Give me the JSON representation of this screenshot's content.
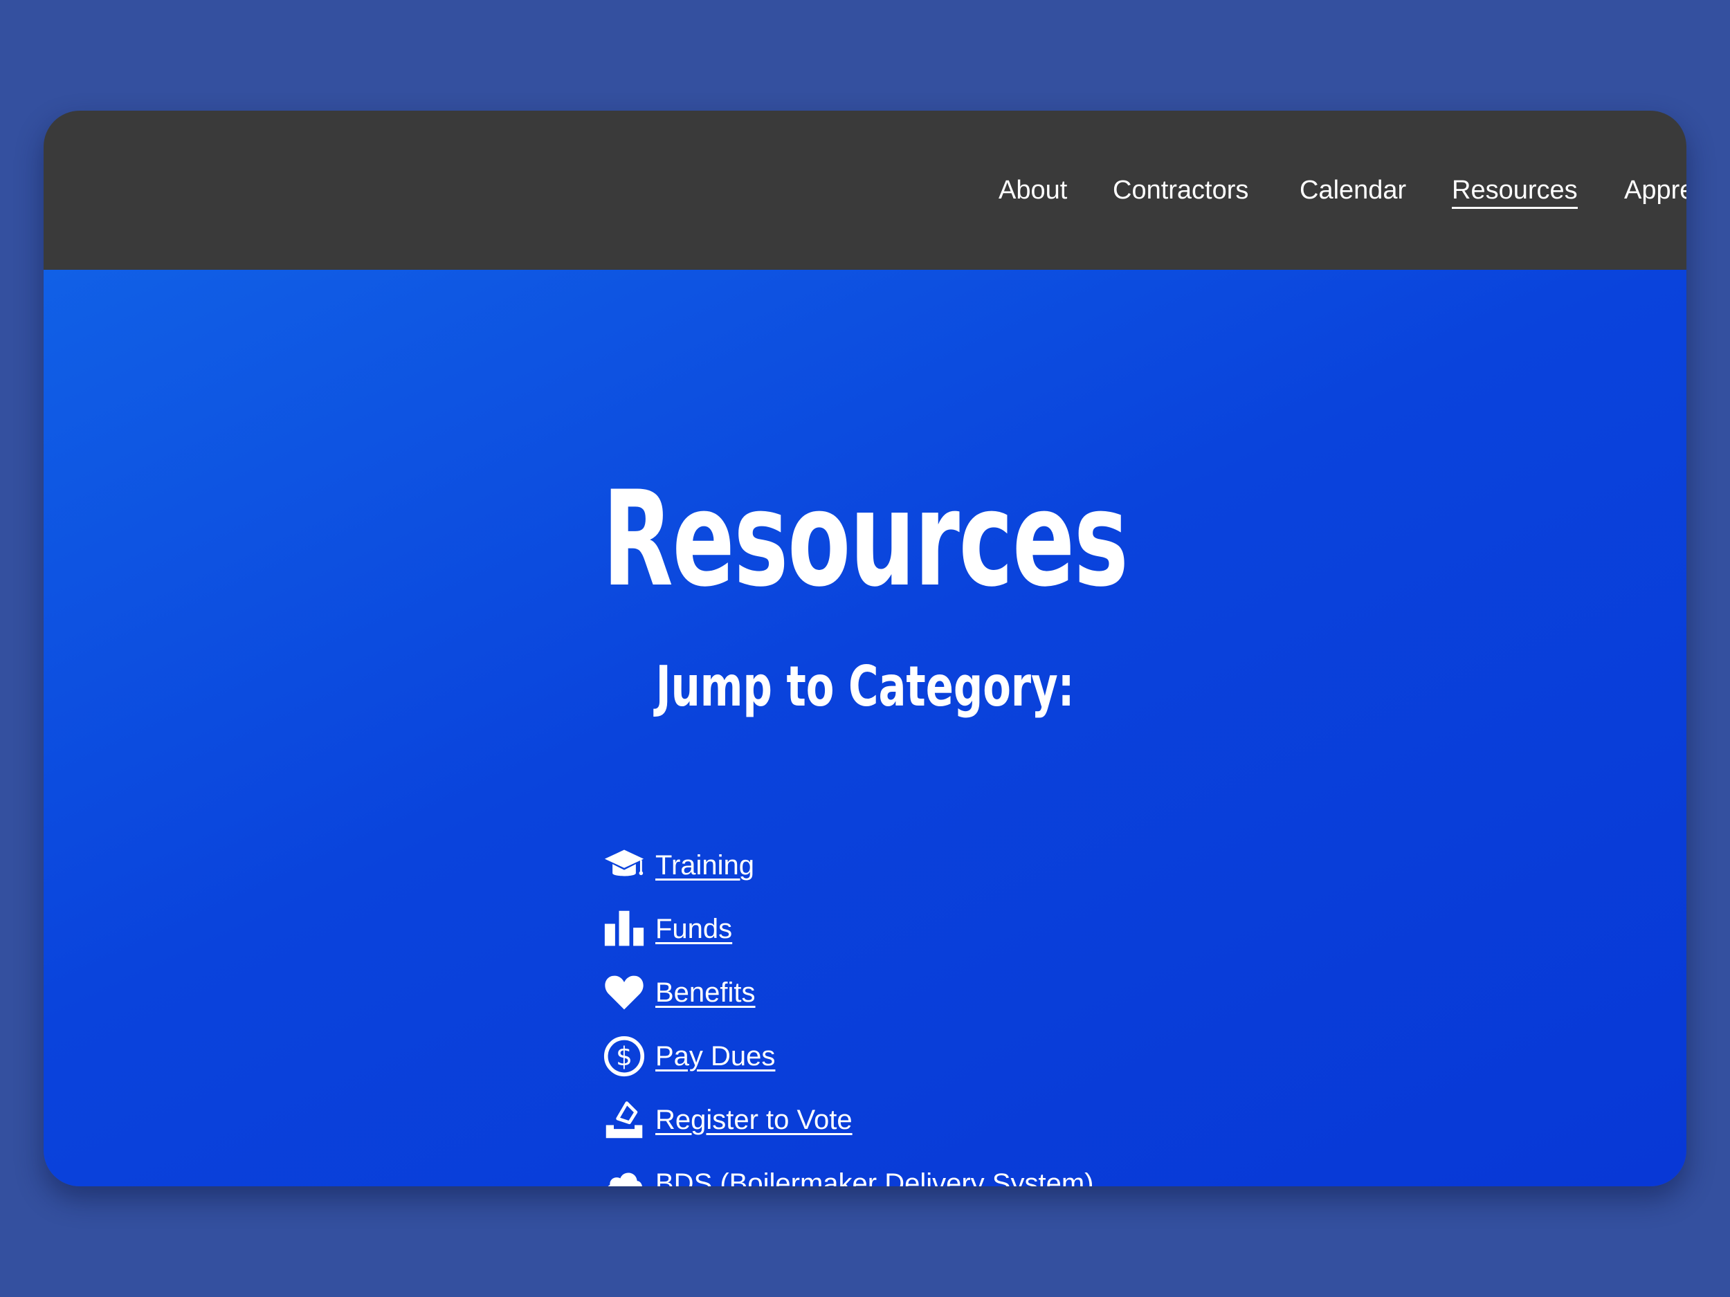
{
  "nav": {
    "items": [
      {
        "label": "About",
        "active": false
      },
      {
        "label": "Contractors",
        "active": false
      },
      {
        "label": "Calendar",
        "active": false
      },
      {
        "label": "Resources",
        "active": true
      },
      {
        "label": "Apprenti",
        "active": false
      }
    ]
  },
  "main": {
    "title": "Resources",
    "subtitle": "Jump to Category:",
    "categories": [
      {
        "label": "Training",
        "icon": "graduation-cap-icon"
      },
      {
        "label": "Funds",
        "icon": "bar-chart-icon"
      },
      {
        "label": "Benefits",
        "icon": "heart-icon"
      },
      {
        "label": "Pay Dues",
        "icon": "dollar-circle-icon"
      },
      {
        "label": "Register to Vote",
        "icon": "ballot-box-icon"
      },
      {
        "label": "BDS (Boilermaker Delivery System)",
        "icon": "cloud-icon"
      }
    ]
  },
  "colors": {
    "page_background": "#34509f",
    "topbar": "#3a3a3a",
    "hero_gradient_start": "#1160e6",
    "hero_gradient_end": "#0838d6",
    "text": "#ffffff"
  }
}
